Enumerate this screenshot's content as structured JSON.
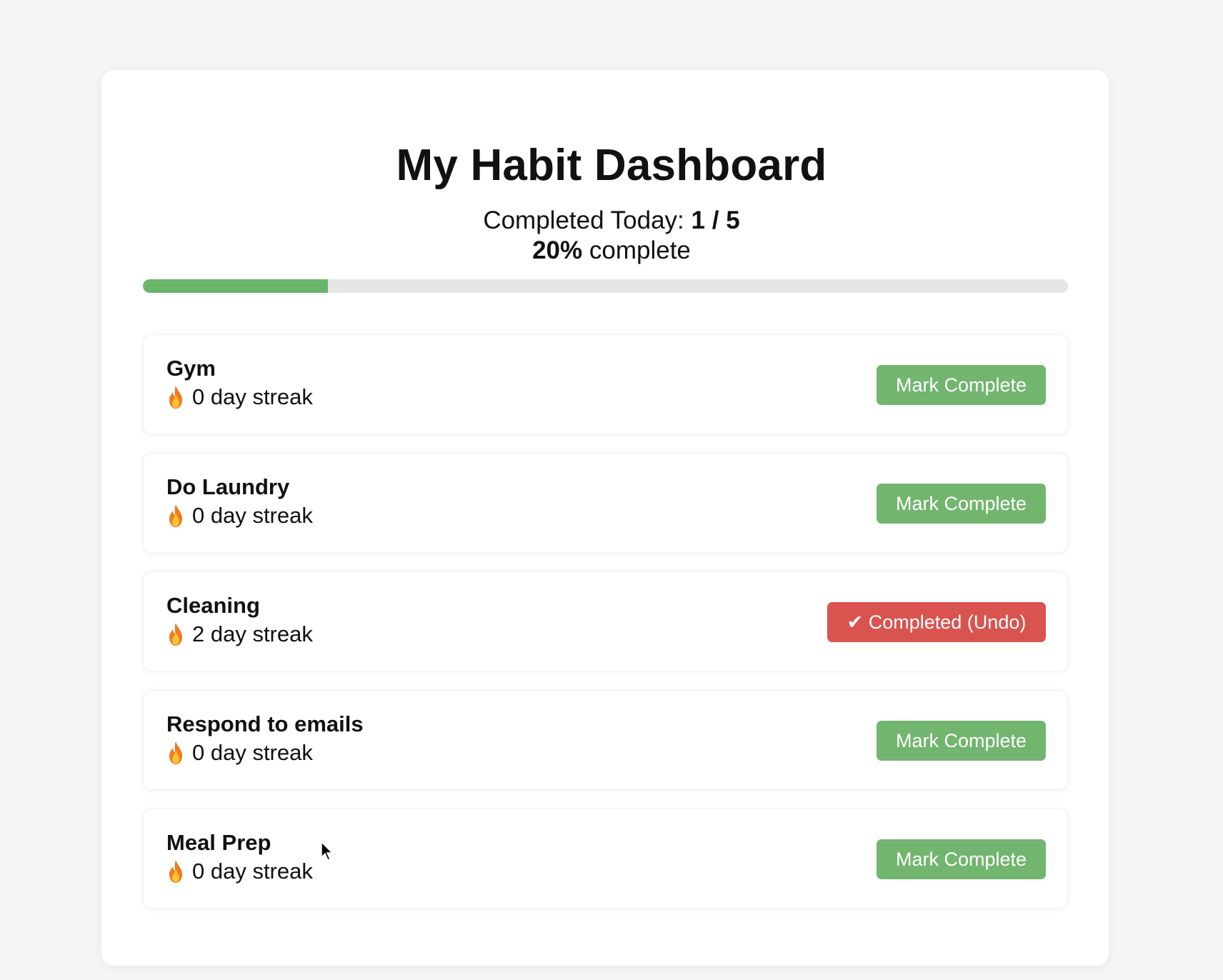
{
  "dashboard": {
    "title": "My Habit Dashboard",
    "completed_label": "Completed Today:",
    "completed_count": "1",
    "separator": "/",
    "total_count": "5",
    "percent": "20%",
    "percent_suffix": "complete",
    "progress_fraction": 0.2,
    "colors": {
      "progress_fill": "#6bb56b",
      "progress_track": "#e6e6e6",
      "complete_button": "#72b56f",
      "undo_button": "#d9534f"
    }
  },
  "habits": [
    {
      "name": "Gym",
      "streak": "0 day streak",
      "icon": "flame-icon",
      "button": "Mark Complete",
      "completed": false
    },
    {
      "name": "Do Laundry",
      "streak": "0 day streak",
      "icon": "flame-icon",
      "button": "Mark Complete",
      "completed": false
    },
    {
      "name": "Cleaning",
      "streak": "2 day streak",
      "icon": "flame-icon",
      "button": "✔ Completed (Undo)",
      "completed": true
    },
    {
      "name": "Respond to emails",
      "streak": "0 day streak",
      "icon": "flame-icon",
      "button": "Mark Complete",
      "completed": false
    },
    {
      "name": "Meal Prep",
      "streak": "0 day streak",
      "icon": "flame-icon",
      "button": "Mark Complete",
      "completed": false
    }
  ]
}
